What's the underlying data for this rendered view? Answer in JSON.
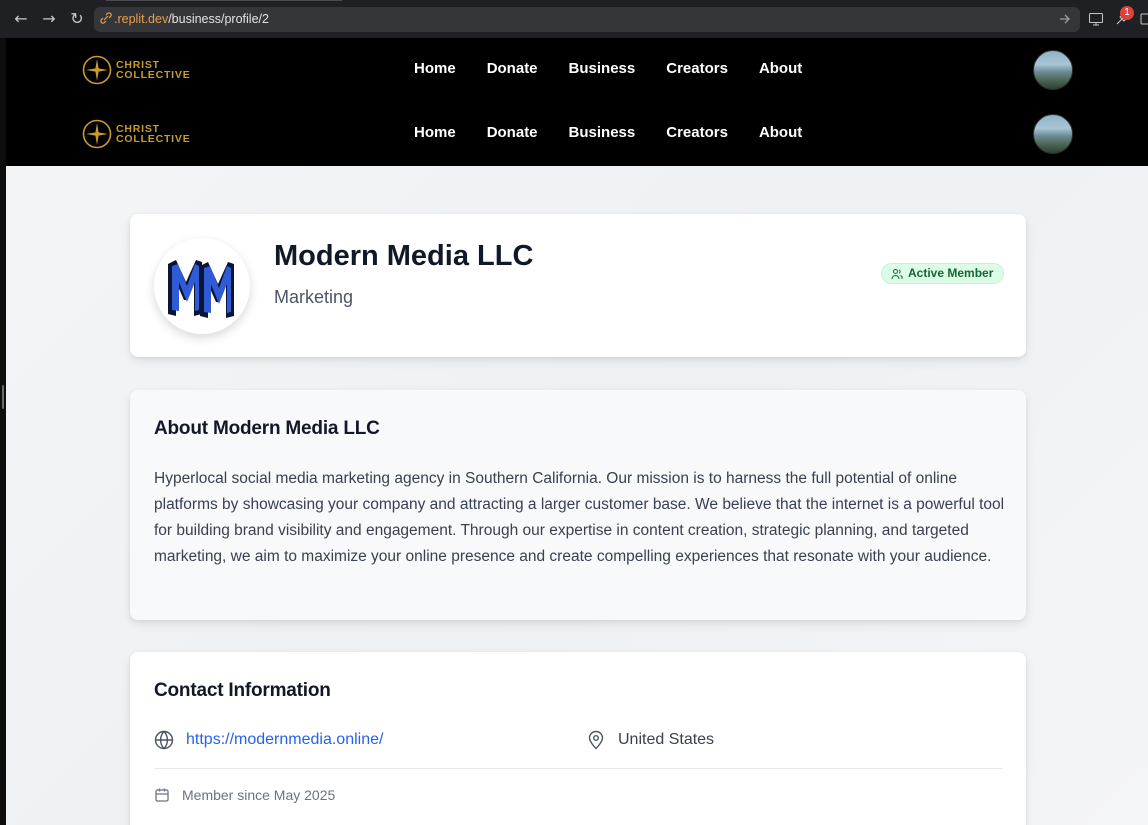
{
  "browser": {
    "url_host": ".replit.dev",
    "url_path": "/business/profile/2",
    "extension_badge": "1"
  },
  "header": {
    "logo_line1": "CHRIST",
    "logo_line2": "COLLECTIVE",
    "nav": [
      "Home",
      "Donate",
      "Business",
      "Creators",
      "About"
    ]
  },
  "profile": {
    "name": "Modern Media LLC",
    "category": "Marketing",
    "status": "Active Member",
    "logo_text": "MM"
  },
  "about": {
    "title": "About Modern Media LLC",
    "body": "Hyperlocal social media marketing agency in Southern California. Our mission is to harness the full potential of online platforms by showcasing your company and attracting a larger customer base. We believe that the internet is a powerful tool for building brand visibility and engagement. Through our expertise in content creation, strategic planning, and targeted marketing, we aim to maximize your online presence and create compelling experiences that resonate with your audience."
  },
  "contact": {
    "title": "Contact Information",
    "website": "https://modernmedia.online/",
    "location": "United States",
    "member_since": "Member since May 2025"
  },
  "colors": {
    "brand_gold": "#c99a2e",
    "link_blue": "#2563eb",
    "badge_green": "#dcfce7"
  }
}
